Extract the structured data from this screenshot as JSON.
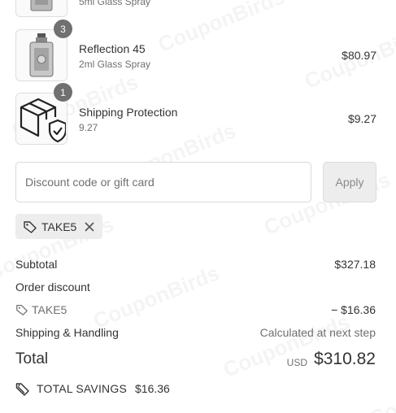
{
  "items": [
    {
      "title": "",
      "subtitle": "5ml Glass Spray",
      "price": "",
      "qty": "",
      "image": "perfume-bottle-icon"
    },
    {
      "title": "Reflection 45",
      "subtitle": "2ml Glass Spray",
      "price": "$80.97",
      "qty": "3",
      "image": "perfume-bottle-icon"
    },
    {
      "title": "Shipping Protection",
      "subtitle": "9.27",
      "price": "$9.27",
      "qty": "1",
      "image": "shield-box-icon"
    }
  ],
  "discount": {
    "placeholder": "Discount code or gift card",
    "apply_label": "Apply",
    "applied_code": "TAKE5"
  },
  "summary": {
    "subtotal_label": "Subtotal",
    "subtotal_value": "$327.18",
    "order_discount_label": "Order discount",
    "discount_code": "TAKE5",
    "discount_value": "− $16.36",
    "shipping_label": "Shipping & Handling",
    "shipping_value": "Calculated at next step",
    "total_label": "Total",
    "total_currency": "USD",
    "total_value": "$310.82",
    "savings_label": "TOTAL SAVINGS",
    "savings_value": "$16.36"
  },
  "watermark": "CouponBirds",
  "colors": {
    "badge": "#707070",
    "apply_bg": "#ededed",
    "pill_bg": "#ededed",
    "text": "#333333",
    "muted": "#707070"
  }
}
